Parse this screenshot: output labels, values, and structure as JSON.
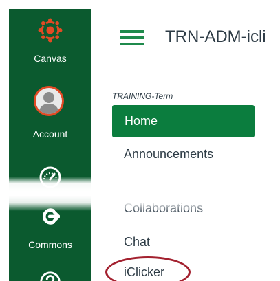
{
  "global_nav": {
    "items": [
      {
        "label": "Canvas",
        "icon": "canvas-logo-icon"
      },
      {
        "label": "Account",
        "icon": "account-avatar-icon"
      },
      {
        "label": "",
        "icon": "dashboard-icon"
      },
      {
        "label": "Commons",
        "icon": "commons-icon"
      },
      {
        "label": "",
        "icon": "help-icon"
      }
    ],
    "background_color": "#0b5a2f",
    "logo_color": "#e24a24"
  },
  "header": {
    "menu_icon": "hamburger-icon",
    "course_title": "TRN-ADM-icli"
  },
  "course_nav": {
    "term": "TRAINING-Term",
    "items": [
      {
        "label": "Home",
        "active": true
      },
      {
        "label": "Announcements",
        "active": false
      },
      {
        "label": "Collaborations",
        "active": false
      },
      {
        "label": "Chat",
        "active": false
      },
      {
        "label": "iClicker",
        "active": false,
        "highlighted": true
      }
    ],
    "active_color": "#0b7d3e",
    "highlight_color": "#a3212f"
  }
}
